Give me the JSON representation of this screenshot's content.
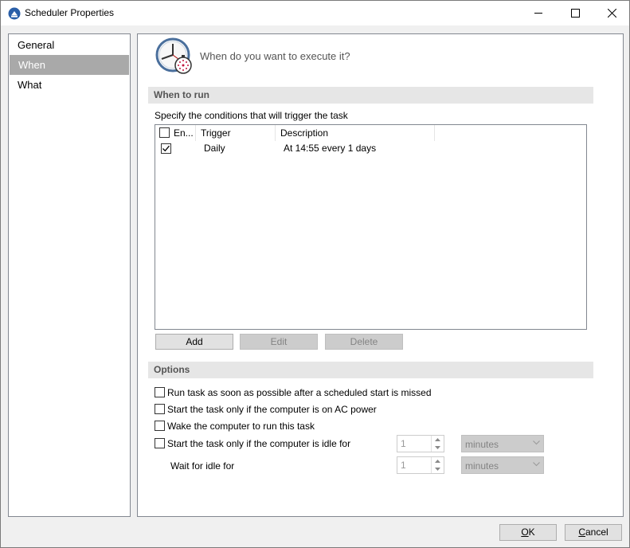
{
  "window": {
    "title": "Scheduler Properties",
    "icons": [
      "app-icon",
      "minimize-icon",
      "maximize-icon",
      "close-icon"
    ]
  },
  "nav": {
    "items": [
      {
        "label": "General",
        "selected": false
      },
      {
        "label": "When",
        "selected": true
      },
      {
        "label": "What",
        "selected": false
      }
    ],
    "selected_color": "#a9a9a9"
  },
  "header": {
    "prompt": "When do you want to execute it?",
    "icon": "clock-stopwatch-icon"
  },
  "when_to_run": {
    "section_title": "When to run",
    "instructions": "Specify the conditions that will trigger the task",
    "columns": {
      "enabled": "En...",
      "trigger": "Trigger",
      "description": "Description"
    },
    "rows": [
      {
        "enabled": true,
        "trigger": "Daily",
        "description": "At 14:55 every 1 days"
      }
    ],
    "buttons": {
      "add": "Add",
      "edit": "Edit",
      "delete": "Delete"
    }
  },
  "options": {
    "section_title": "Options",
    "run_missed": {
      "label": "Run task as soon as possible after a scheduled start is missed",
      "checked": false
    },
    "ac_power": {
      "label": "Start the task only if the computer is on AC power",
      "checked": false
    },
    "wake": {
      "label": "Wake the computer to run this task",
      "checked": false
    },
    "idle": {
      "label": "Start the task only if the computer is idle for",
      "checked": false,
      "value": "1",
      "unit": "minutes"
    },
    "wait_idle": {
      "label": "Wait for idle for",
      "value": "1",
      "unit": "minutes"
    }
  },
  "footer": {
    "ok_letter": "O",
    "ok_rest": "K",
    "cancel_letter": "C",
    "cancel_rest": "ancel"
  }
}
